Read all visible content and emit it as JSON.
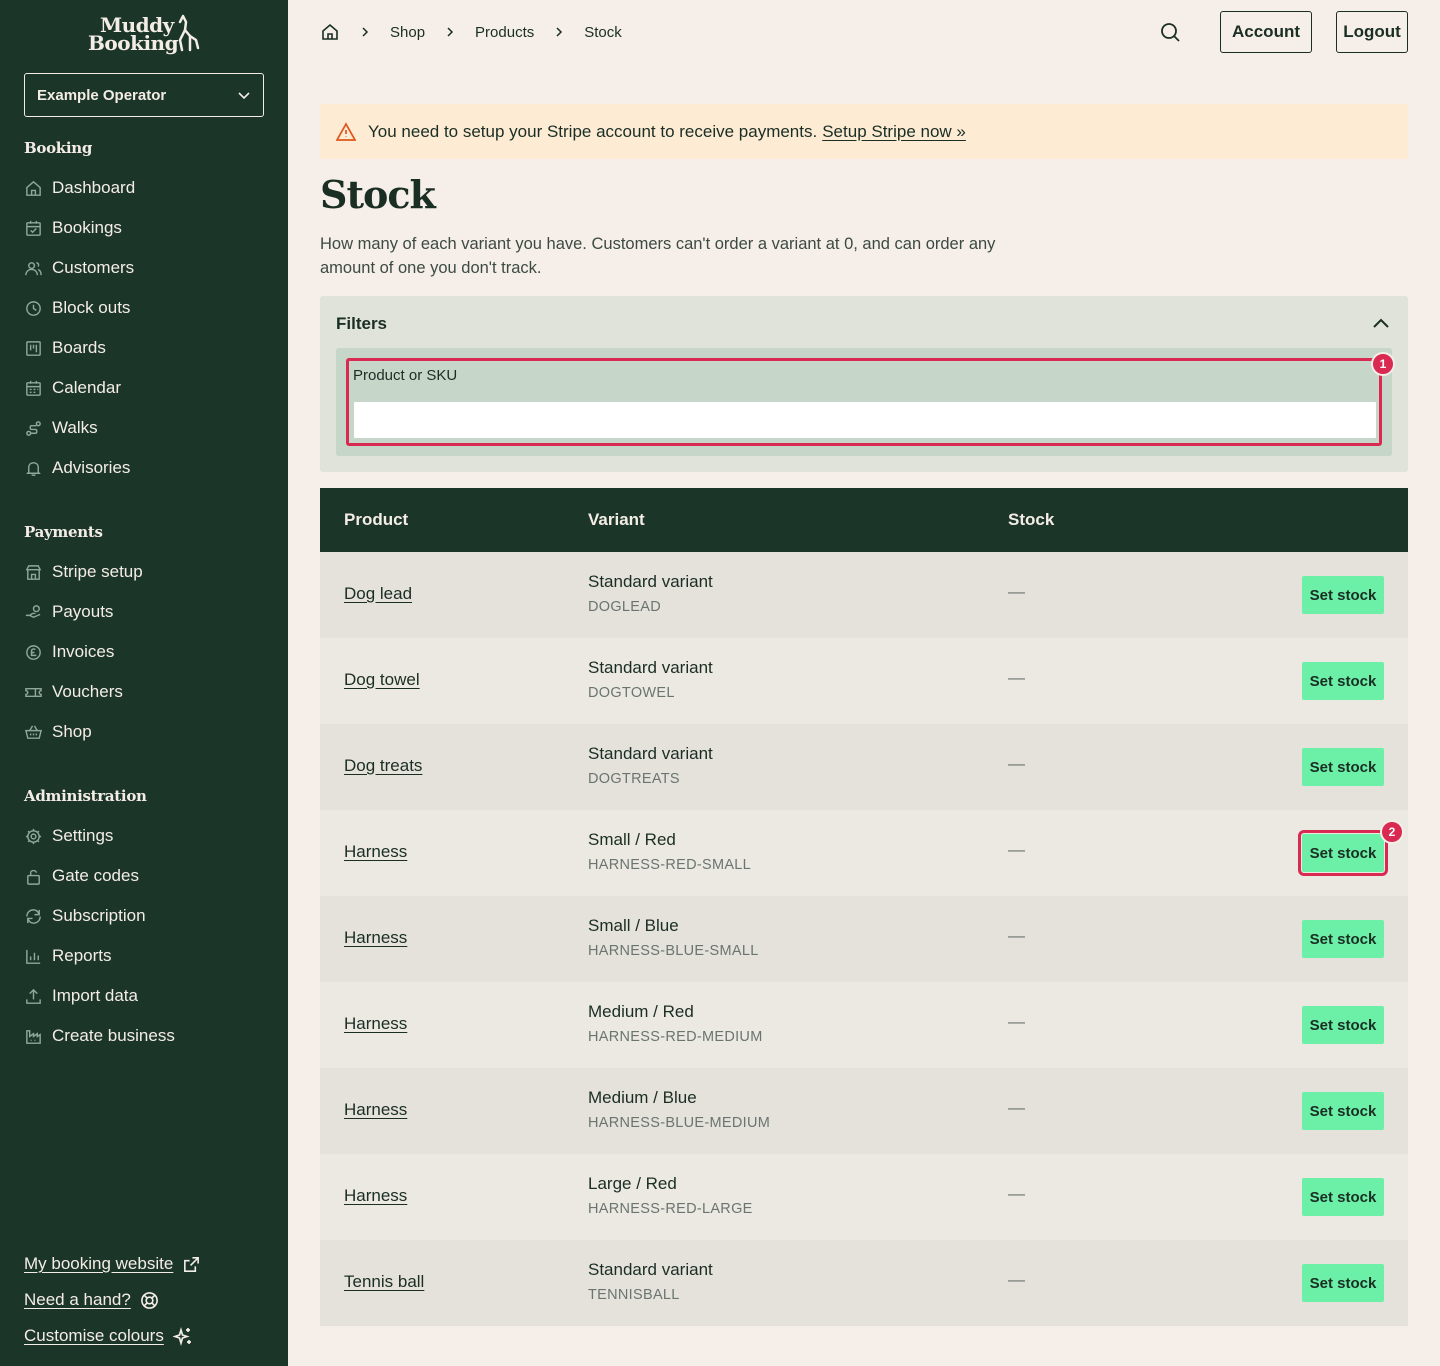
{
  "brand": {
    "line1": "Muddy",
    "line2": "Booking"
  },
  "operator": {
    "name": "Example Operator"
  },
  "sidebar": {
    "sections": [
      {
        "title": "Booking",
        "items": [
          {
            "label": "Dashboard",
            "icon": "home-icon"
          },
          {
            "label": "Bookings",
            "icon": "calendar-check-icon"
          },
          {
            "label": "Customers",
            "icon": "users-icon"
          },
          {
            "label": "Block outs",
            "icon": "clock-icon"
          },
          {
            "label": "Boards",
            "icon": "board-icon"
          },
          {
            "label": "Calendar",
            "icon": "calendar-icon"
          },
          {
            "label": "Walks",
            "icon": "route-icon"
          },
          {
            "label": "Advisories",
            "icon": "bell-icon"
          }
        ]
      },
      {
        "title": "Payments",
        "items": [
          {
            "label": "Stripe setup",
            "icon": "store-icon"
          },
          {
            "label": "Payouts",
            "icon": "hand-coins-icon"
          },
          {
            "label": "Invoices",
            "icon": "pound-icon"
          },
          {
            "label": "Vouchers",
            "icon": "ticket-icon"
          },
          {
            "label": "Shop",
            "icon": "basket-icon"
          }
        ]
      },
      {
        "title": "Administration",
        "items": [
          {
            "label": "Settings",
            "icon": "gear-icon"
          },
          {
            "label": "Gate codes",
            "icon": "lock-icon"
          },
          {
            "label": "Subscription",
            "icon": "refresh-icon"
          },
          {
            "label": "Reports",
            "icon": "chart-icon"
          },
          {
            "label": "Import data",
            "icon": "upload-icon"
          },
          {
            "label": "Create business",
            "icon": "factory-icon"
          }
        ]
      }
    ],
    "footer": [
      {
        "label": "My booking website",
        "icon": "external-link-icon"
      },
      {
        "label": "Need a hand?",
        "icon": "lifebuoy-icon"
      },
      {
        "label": "Customise colours",
        "icon": "sparkles-icon"
      }
    ]
  },
  "breadcrumb": {
    "items": [
      "Shop",
      "Products",
      "Stock"
    ]
  },
  "header": {
    "account_label": "Account",
    "logout_label": "Logout"
  },
  "alert": {
    "text": "You need to setup your Stripe account to receive payments.",
    "link": "Setup Stripe now »"
  },
  "page": {
    "title": "Stock",
    "description": "How many of each variant you have. Customers can't order a variant at 0, and can order any amount of one you don't track."
  },
  "filters": {
    "title": "Filters",
    "field_label": "Product or SKU",
    "field_value": "",
    "badge": "1"
  },
  "table": {
    "columns": [
      "Product",
      "Variant",
      "Stock"
    ],
    "action_label": "Set stock",
    "highlight_badge": "2",
    "rows": [
      {
        "product": "Dog lead",
        "variant": "Standard variant",
        "sku": "DOGLEAD",
        "stock": "—"
      },
      {
        "product": "Dog towel",
        "variant": "Standard variant",
        "sku": "DOGTOWEL",
        "stock": "—"
      },
      {
        "product": "Dog treats",
        "variant": "Standard variant",
        "sku": "DOGTREATS",
        "stock": "—"
      },
      {
        "product": "Harness",
        "variant": "Small / Red",
        "sku": "HARNESS-RED-SMALL",
        "stock": "—"
      },
      {
        "product": "Harness",
        "variant": "Small / Blue",
        "sku": "HARNESS-BLUE-SMALL",
        "stock": "—"
      },
      {
        "product": "Harness",
        "variant": "Medium / Red",
        "sku": "HARNESS-RED-MEDIUM",
        "stock": "—"
      },
      {
        "product": "Harness",
        "variant": "Medium / Blue",
        "sku": "HARNESS-BLUE-MEDIUM",
        "stock": "—"
      },
      {
        "product": "Harness",
        "variant": "Large / Red",
        "sku": "HARNESS-RED-LARGE",
        "stock": "—"
      },
      {
        "product": "Tennis ball",
        "variant": "Standard variant",
        "sku": "TENNISBALL",
        "stock": "—"
      }
    ]
  },
  "colors": {
    "sidebar": "#1c3529",
    "background": "#f6efe9",
    "accent": "#6cf0a8",
    "highlight": "#d92a52",
    "alert_bg": "#fdebd4"
  }
}
